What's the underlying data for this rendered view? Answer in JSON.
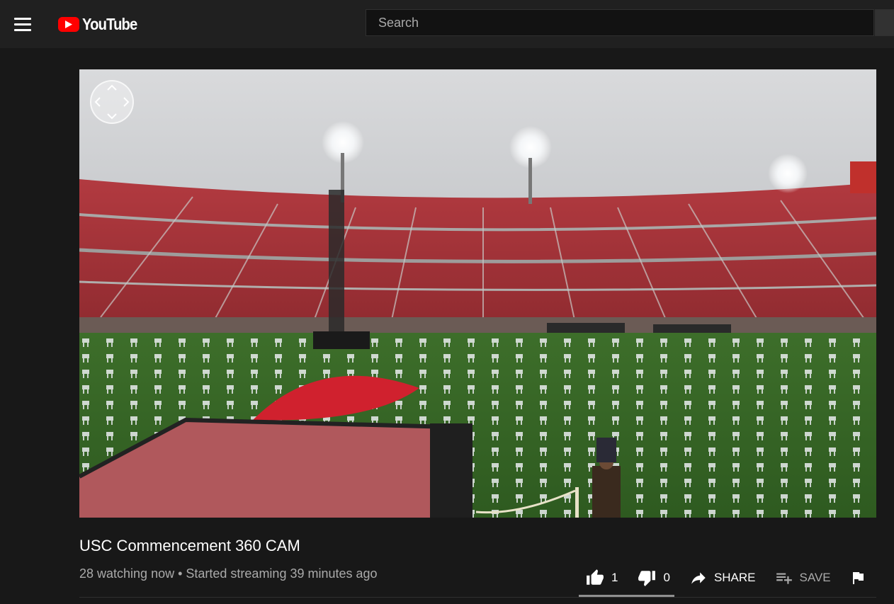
{
  "header": {
    "logo_text": "YouTube",
    "search_placeholder": "Search"
  },
  "video": {
    "title": "USC Commencement 360 CAM",
    "meta": "28 watching now • Started streaming 39 minutes ago"
  },
  "actions": {
    "like_count": "1",
    "dislike_count": "0",
    "share_label": "SHARE",
    "save_label": "SAVE"
  },
  "colors": {
    "brand": "#ff0000",
    "background": "#181818",
    "header": "#202020"
  }
}
